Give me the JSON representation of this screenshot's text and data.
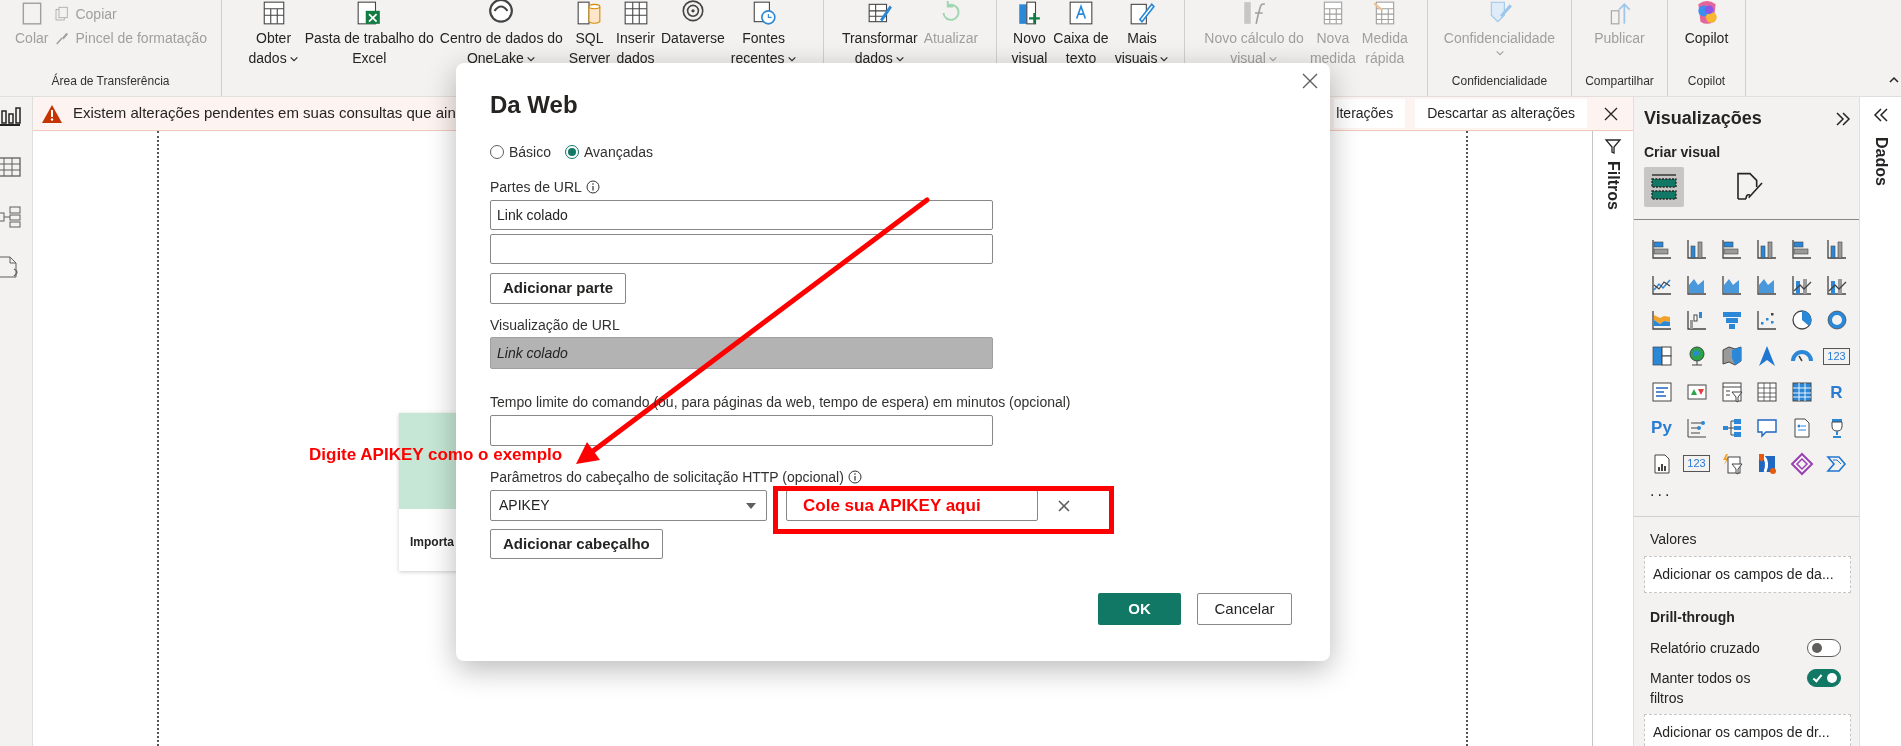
{
  "ribbon": {
    "groups": [
      {
        "label": "Área de Transferência",
        "items": [
          {
            "kind": "large",
            "label": "Colar",
            "disabled": true,
            "dropdown": false
          },
          {
            "kind": "small",
            "label": "Copiar",
            "disabled": true,
            "dropdown": false
          },
          {
            "kind": "small",
            "label": "Pincel de formatação",
            "disabled": true,
            "dropdown": false
          }
        ]
      },
      {
        "items": [
          {
            "kind": "large",
            "label": "Obter\ndados",
            "disabled": false,
            "dropdown": true
          },
          {
            "kind": "large",
            "label": "Pasta de trabalho do\nExcel",
            "disabled": false,
            "dropdown": false
          },
          {
            "kind": "large",
            "label": "Centro de dados do\nOneLake",
            "disabled": false,
            "dropdown": true
          },
          {
            "kind": "large",
            "label": "SQL\nServer",
            "disabled": false,
            "dropdown": false
          },
          {
            "kind": "large",
            "label": "Inserir\ndados",
            "disabled": false,
            "dropdown": false
          },
          {
            "kind": "large",
            "label": "Dataverse",
            "disabled": false,
            "dropdown": false
          },
          {
            "kind": "large",
            "label": "Fontes\nrecentes",
            "disabled": false,
            "dropdown": true
          }
        ]
      },
      {
        "items": [
          {
            "kind": "large",
            "label": "Transformar\ndados",
            "disabled": false,
            "dropdown": true
          },
          {
            "kind": "large",
            "label": "Atualizar",
            "disabled": true,
            "dropdown": false
          }
        ]
      },
      {
        "items": [
          {
            "kind": "large",
            "label": "Novo\nvisual",
            "disabled": false,
            "dropdown": false
          },
          {
            "kind": "large",
            "label": "Caixa de\ntexto",
            "disabled": false,
            "dropdown": false
          },
          {
            "kind": "large",
            "label": "Mais\nvisuais",
            "disabled": false,
            "dropdown": true
          }
        ]
      },
      {
        "items": [
          {
            "kind": "large",
            "label": "Novo cálculo do\nvisual",
            "disabled": true,
            "dropdown": true
          },
          {
            "kind": "large",
            "label": "Nova\nmedida",
            "disabled": true,
            "dropdown": false
          },
          {
            "kind": "large",
            "label": "Medida\nrápida",
            "disabled": true,
            "dropdown": false
          }
        ]
      },
      {
        "label": "Confidencialidade",
        "items": [
          {
            "kind": "large",
            "label": "Confidencialidade",
            "disabled": true,
            "dropdown": true
          }
        ]
      },
      {
        "label": "Compartilhar",
        "items": [
          {
            "kind": "large",
            "label": "Publicar",
            "disabled": true,
            "dropdown": false
          }
        ]
      },
      {
        "label": "Copilot",
        "items": [
          {
            "kind": "large",
            "label": "Copilot",
            "disabled": false,
            "dropdown": false
          }
        ]
      }
    ]
  },
  "warning": {
    "message": "Existem alterações pendentes em suas consultas que ain",
    "buttons": [
      "lterações",
      "Descartar as alterações"
    ]
  },
  "background_card": {
    "text": "Importa"
  },
  "filters_pane": {
    "title": "Filtros"
  },
  "visualizations_pane": {
    "title": "Visualizações",
    "section": "Criar visual",
    "tabs": [
      {
        "kind": "build",
        "selected": true
      },
      {
        "kind": "format",
        "selected": false
      }
    ],
    "icon_glyphs": [
      "123",
      "R",
      "Py",
      "123"
    ],
    "more": "...",
    "values_well": {
      "label": "Valores",
      "placeholder": "Adicionar os campos de da..."
    },
    "drillthrough": {
      "title": "Drill-through",
      "toggles": [
        {
          "label": "Relatório cruzado",
          "on": false
        },
        {
          "label": "Manter todos os filtros",
          "on": true
        }
      ],
      "placeholder": "Adicionar os campos de dr..."
    }
  },
  "data_pane": {
    "title": "Dados"
  },
  "dialog": {
    "title": "Da Web",
    "modes": [
      {
        "label": "Básico",
        "selected": false
      },
      {
        "label": "Avançadas",
        "selected": true
      }
    ],
    "url_parts": {
      "label": "Partes de URL",
      "fields": [
        {
          "kind": "filled",
          "value": "Link colado"
        },
        {
          "kind": "blank"
        }
      ],
      "add_button": "Adicionar parte"
    },
    "preview": {
      "label": "Visualização de URL",
      "value": "Link colado"
    },
    "timeout": {
      "label": "Tempo limite do comando (ou, para páginas da web, tempo de espera) em minutos (opcional)"
    },
    "headers": {
      "label": "Parâmetros do cabeçalho de solicitação HTTP (opcional)",
      "rows": [
        {
          "name": "APIKEY",
          "value": "Cole sua APIKEY aqui"
        }
      ],
      "add_button": "Adicionar cabeçalho"
    },
    "buttons": [
      {
        "label": "OK",
        "kind": "primary"
      },
      {
        "label": "Cancelar",
        "kind": "secondary"
      }
    ]
  },
  "annotation": {
    "note": "Digite APIKEY como o exemplo"
  }
}
